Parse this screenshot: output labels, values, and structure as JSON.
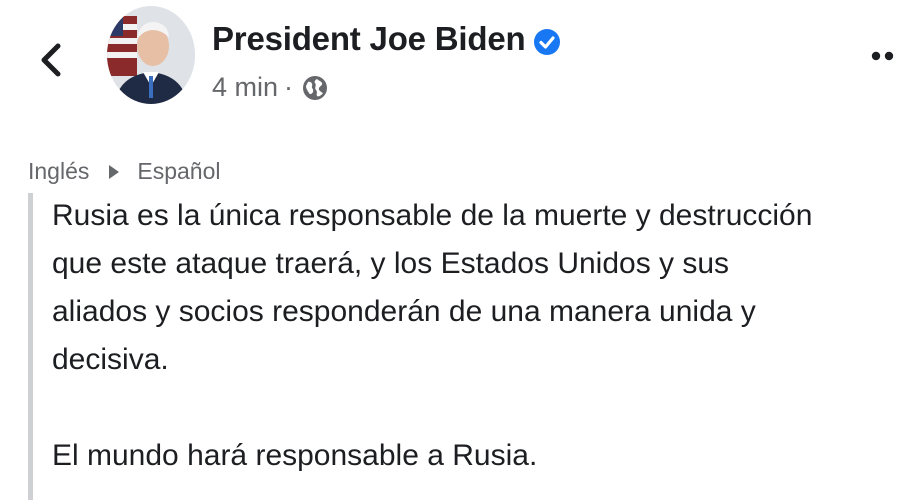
{
  "header": {
    "author_name": "President Joe Biden",
    "timestamp": "4 min",
    "separator": "·",
    "audience_icon": "globe-icon",
    "verified_icon": "verified-badge-icon",
    "back_icon": "chevron-left-icon",
    "more_icon": "more-options-icon"
  },
  "translation": {
    "from_language": "Inglés",
    "to_language": "Español"
  },
  "post": {
    "lines": [
      "Rusia es la única responsable de la muerte y destrucción",
      "que este ataque traerá, y los Estados Unidos y sus",
      "aliados y socios responderán de una manera unida y",
      "decisiva."
    ],
    "closing": "El mundo hará responsable a Rusia."
  },
  "colors": {
    "text": "#1c1e21",
    "secondary": "#65676b",
    "verified": "#1877f2",
    "quote_bar": "#ced0d4"
  }
}
